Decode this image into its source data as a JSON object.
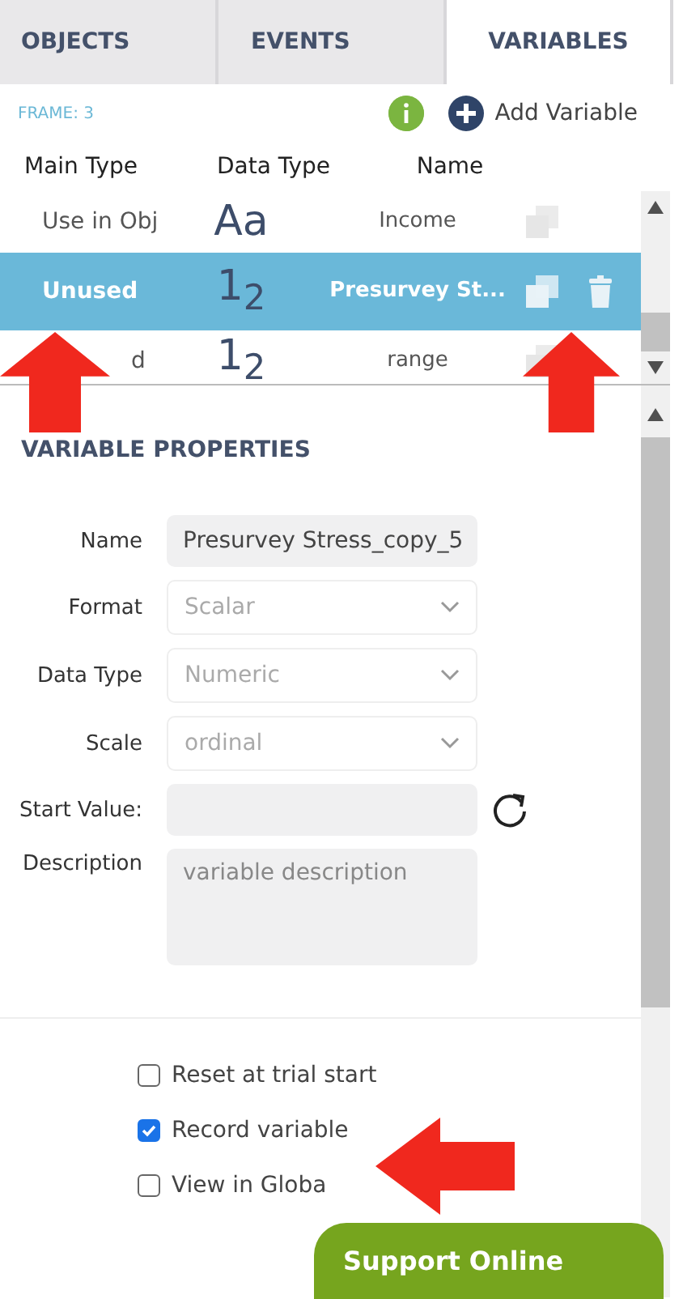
{
  "tabs": [
    {
      "label": "OBJECTS",
      "selected": false
    },
    {
      "label": "EVENTS",
      "selected": false
    },
    {
      "label": "VARIABLES",
      "selected": true
    }
  ],
  "frame_label": "FRAME: 3",
  "add_button": "Add Variable",
  "columns": [
    "Main Type",
    "Data Type",
    "Name"
  ],
  "rows": [
    {
      "main_type": "Use in Obj",
      "data_type": "Aa",
      "name": "Income",
      "selected": false,
      "actions": [
        {
          "kind": "copy"
        }
      ]
    },
    {
      "main_type": "Unused",
      "data_type": "1$_{2}$",
      "name": "Presurvey St...",
      "selected": true,
      "actions": [
        {
          "kind": "copy"
        },
        {
          "kind": "delete"
        }
      ]
    },
    {
      "main_type": "d",
      "data_type": "1$_{2}$",
      "name": "range",
      "selected": false,
      "actions": [
        {
          "kind": "copy"
        }
      ]
    }
  ],
  "properties": {
    "title": "VARIABLE PROPERTIES",
    "fields": [
      {
        "label": "Name",
        "kind": "text",
        "value": "Presurvey Stress_copy_5"
      },
      {
        "label": "Format",
        "kind": "select",
        "value": "Scalar"
      },
      {
        "label": "Data Type",
        "kind": "select",
        "value": "Numeric"
      },
      {
        "label": "Scale",
        "kind": "select",
        "value": "ordinal"
      },
      {
        "label": "Start Value:",
        "kind": "reset"
      },
      {
        "label": "Description",
        "kind": "textarea",
        "placeholder": "variable description"
      }
    ],
    "options": [
      {
        "label": "Reset at trial start",
        "checked": false
      },
      {
        "label": "Record variable",
        "checked": true
      },
      {
        "label": "View in Globa",
        "checked": false
      }
    ]
  },
  "support_button": "Support Online",
  "annotations": [
    {
      "kind": "up-arrow"
    },
    {
      "kind": "up-arrow"
    },
    {
      "kind": "left-arrow"
    }
  ]
}
